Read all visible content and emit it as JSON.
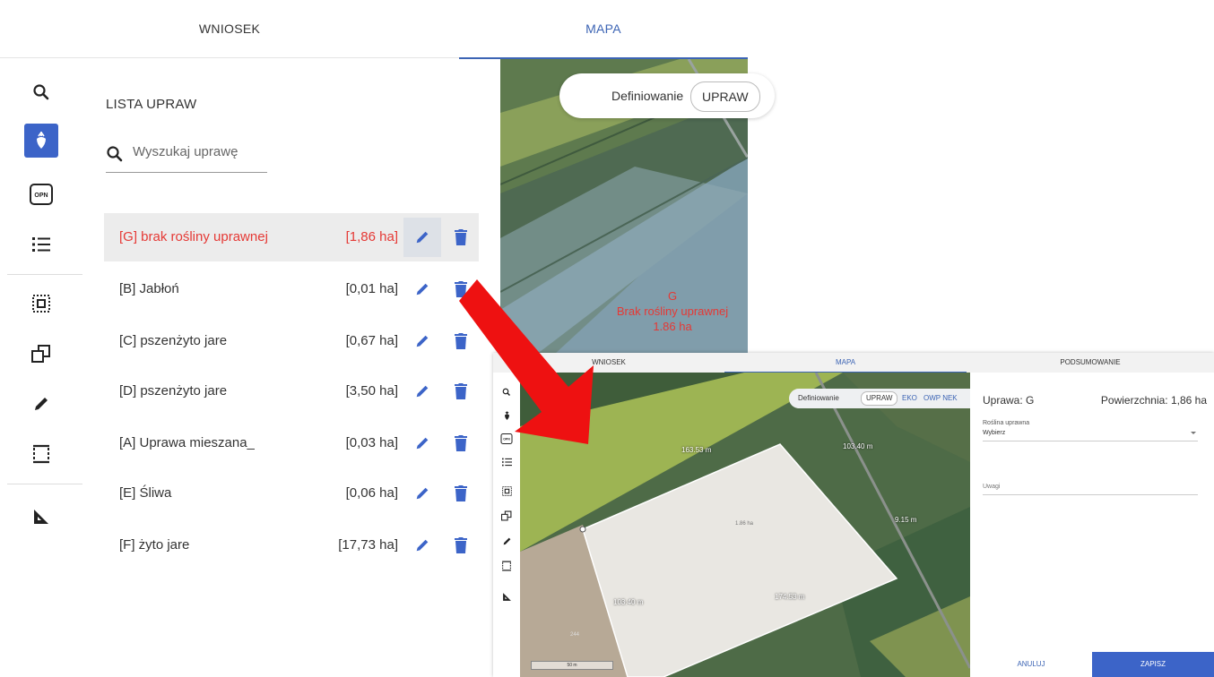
{
  "main": {
    "tabs": [
      {
        "label": "WNIOSEK",
        "active": false
      },
      {
        "label": "MAPA",
        "active": true
      }
    ],
    "list": {
      "title": "LISTA UPRAW",
      "search_placeholder": "Wyszukaj uprawę",
      "crops": [
        {
          "name": "[G] brak rośliny uprawnej",
          "area": "[1,86 ha]",
          "selected": true
        },
        {
          "name": "[B] Jabłoń",
          "area": "[0,01 ha]"
        },
        {
          "name": "[C] pszenżyto jare",
          "area": "[0,67 ha]"
        },
        {
          "name": "[D] pszenżyto jare",
          "area": "[3,50 ha]"
        },
        {
          "name": "[A] Uprawa mieszana_",
          "area": "[0,03 ha]"
        },
        {
          "name": "[E] Śliwa",
          "area": "[0,06 ha]"
        },
        {
          "name": "[F] żyto jare",
          "area": "[17,73 ha]"
        }
      ]
    },
    "map": {
      "mode_label": "Definiowanie",
      "mode_upraw": "UPRAW",
      "parcel_label_line1": "G",
      "parcel_label_line2": "Brak rośliny uprawnej",
      "parcel_label_line3": "1.86 ha"
    }
  },
  "inset": {
    "tabs": [
      {
        "label": "WNIOSEK"
      },
      {
        "label": "MAPA",
        "active": true
      },
      {
        "label": "PODSUMOWANIE"
      }
    ],
    "map": {
      "mode_label": "Definiowanie",
      "mode_upraw": "UPRAW",
      "mode_eko": "EKO",
      "mode_owp": "OWP NEK",
      "measurements": [
        "163.53 m",
        "103.40 m",
        "9.15 m",
        "1.86 ha",
        "103.40 m",
        "174.53 m",
        "244"
      ],
      "scale": "50 m"
    },
    "form": {
      "title": "Uprawa: G",
      "area": "Powierzchnia: 1,86 ha",
      "crop_select_label": "Roślina uprawna",
      "crop_select_value": "Wybierz",
      "notes_placeholder": "Uwagi",
      "cancel": "ANULUJ",
      "save": "ZAPISZ"
    }
  },
  "colors": {
    "accent": "#3c64c8",
    "selected_text": "#e53935",
    "arrow": "#ee1111"
  }
}
